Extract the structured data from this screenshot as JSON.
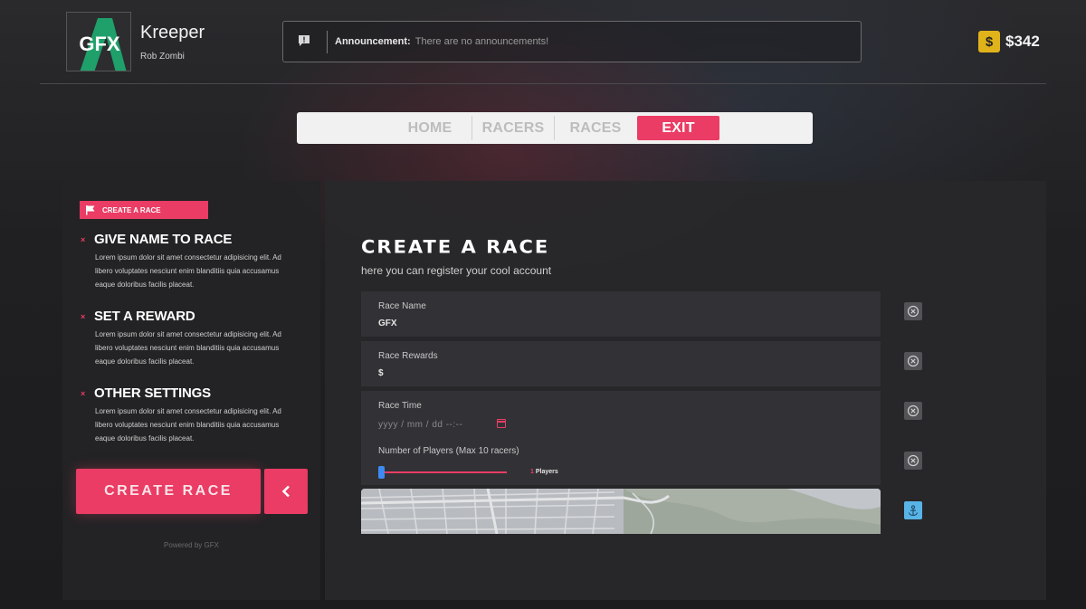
{
  "profile": {
    "logo_text": "GFX",
    "name": "Kreeper",
    "subtitle": "Rob Zombi"
  },
  "announcement": {
    "label": "Announcement:",
    "message": "There are no announcements!"
  },
  "wallet": {
    "currency_icon": "dollar-icon",
    "amount": "$342"
  },
  "nav": {
    "items": [
      {
        "label": "HOME",
        "active": false
      },
      {
        "label": "RACERS",
        "active": false
      },
      {
        "label": "RACES",
        "active": false
      },
      {
        "label": "EXIT",
        "active": true
      }
    ]
  },
  "sidebar": {
    "badge": "CREATE A RACE",
    "steps": [
      {
        "marker": "×",
        "title": "GIVE NAME TO RACE",
        "desc": "Lorem ipsum dolor sit amet consectetur adipisicing elit. Ad libero voluptates nesciunt enim blanditiis quia accusamus eaque doloribus facilis placeat."
      },
      {
        "marker": "×",
        "title": "SET A REWARD",
        "desc": "Lorem ipsum dolor sit amet consectetur adipisicing elit. Ad libero voluptates nesciunt enim blanditiis quia accusamus eaque doloribus facilis placeat."
      },
      {
        "marker": "×",
        "title": "OTHER SETTINGS",
        "desc": "Lorem ipsum dolor sit amet consectetur adipisicing elit. Ad libero voluptates nesciunt enim blanditiis quia accusamus eaque doloribus facilis placeat."
      }
    ],
    "create_button": "CREATE RACE",
    "powered_by": "Powered by GFX"
  },
  "form": {
    "title": "CREATE A RACE",
    "subtitle": "here you can register your cool account",
    "race_name": {
      "label": "Race Name",
      "value": "GFX"
    },
    "race_rewards": {
      "label": "Race Rewards",
      "value": "$"
    },
    "race_time": {
      "label": "Race Time",
      "placeholder": "yyyy / mm / dd  --:--"
    },
    "players": {
      "label": "Number of Players (Max 10 racers)",
      "value": "1",
      "unit": "Players",
      "min": 1,
      "max": 10
    }
  },
  "colors": {
    "accent": "#ea3c64",
    "slider_thumb": "#3d8bf2",
    "coin": "#e0b31b",
    "anchor_button": "#58b4e6"
  }
}
